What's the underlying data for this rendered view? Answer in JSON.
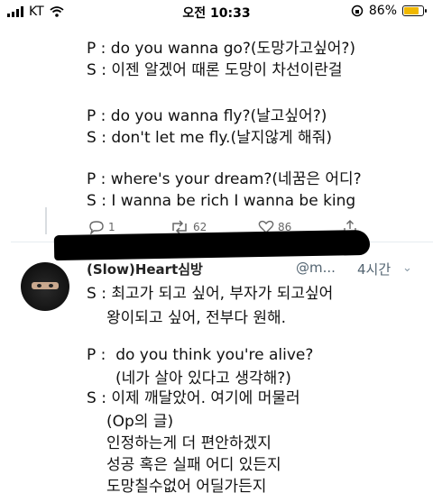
{
  "status_bar": {
    "carrier": "KT",
    "time": "오전 10:33",
    "battery": "86%",
    "battery_level": 0.86
  },
  "tweet": {
    "lines": [
      "P : do you wanna go?(도망가고싶어?)",
      "S : 이젠 알겠어 때론 도망이 차선이란걸",
      "P : do you wanna fly?(날고싶어?)",
      "S : don't let me fly.(날지않게 해줘)",
      "P : where's your dream?(네꿈은 어디?",
      "S : I wanna be rich I wanna be king"
    ],
    "actions": {
      "replies": "1",
      "retweets": "62",
      "likes": "86"
    }
  },
  "reply": {
    "name": "(Slow)Heart심방",
    "handle": "@m...",
    "time": "4시간",
    "lines": [
      "S : 최고가 되고 싶어, 부자가 되고싶어",
      "왕이되고 싶어, 전부다 원해.",
      "P :  do you think you're alive?",
      "(네가 살아 있다고 생각해?)",
      "S : 이제 깨달았어. 여기에 머물러",
      "(Op의 글)",
      "인정하는게 더 편안하겠지",
      "성공 혹은 실패 어디 있든지",
      "도망칠수없어 어딜가든지"
    ]
  },
  "colors": {
    "battery_fill": "#f0b800",
    "secondary_text": "#536471",
    "divider": "#e6ecf0"
  }
}
